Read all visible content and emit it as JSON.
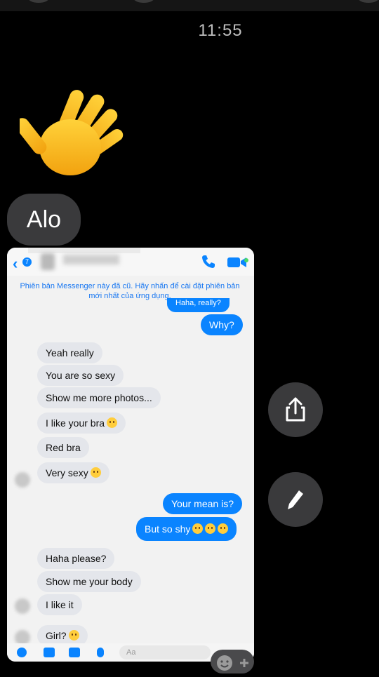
{
  "status": {
    "time": "11:55"
  },
  "chat": {
    "wave_emoji": "waving-hand",
    "alo_message": "Alo"
  },
  "screenshot": {
    "notice": "Phiên bản Messenger này đã cũ. Hãy nhấn để cài đặt phiên bản mới nhất của ứng dụng.",
    "back_count": "7",
    "partial_top_message": "Haha, really?",
    "messages": {
      "why": "Why?",
      "yeah_really": "Yeah really",
      "so_sexy": "You are so sexy",
      "more_photos": "Show me more photos...",
      "like_bra": "I like your bra",
      "red_bra": "Red bra",
      "very_sexy": "Very sexy",
      "your_mean": "Your mean is?",
      "so_shy": "But so shy",
      "haha_please": "Haha please?",
      "show_body": "Show me your body",
      "like_it": "I like it",
      "girl": "Girl?"
    },
    "composer_placeholder": "Aa",
    "colors": {
      "outgoing": "#0a84ff",
      "incoming": "#e4e6eb",
      "accent": "#0a84ff"
    }
  },
  "controls": {
    "share_icon": "share-icon",
    "edit_icon": "pencil-icon",
    "reaction_icon": "add-reaction-icon"
  }
}
